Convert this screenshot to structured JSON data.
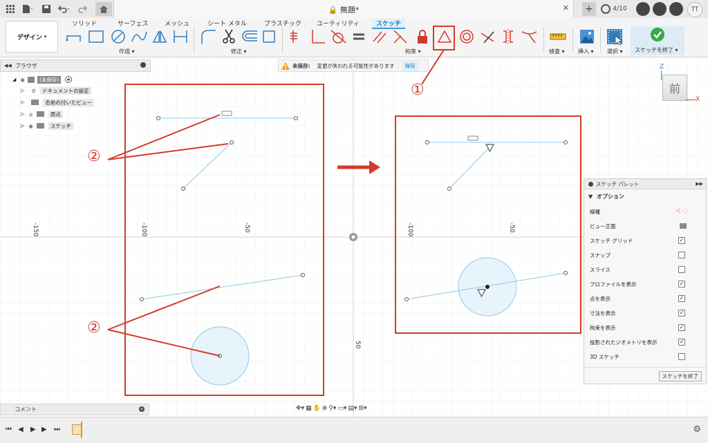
{
  "title_bar": {
    "document_title": "無題*",
    "job_status": "4/10",
    "user_initials": "TT",
    "icons": [
      "grid-icon",
      "file-icon",
      "save-icon",
      "undo-icon",
      "redo-icon",
      "home-icon",
      "close-icon",
      "plus-icon",
      "clock-icon",
      "bell-icon",
      "help-icon"
    ]
  },
  "ribbon": {
    "workspace": "デザイン",
    "tabs": [
      "ソリッド",
      "サーフェス",
      "メッシュ",
      "シート メタル",
      "プラスチック",
      "ユーティリティ",
      "スケッチ"
    ],
    "active_tab": "スケッチ",
    "groups": {
      "create": "作成",
      "modify": "修正",
      "constraints": "拘束",
      "inspect": "検査",
      "insert": "挿入",
      "select": "選択",
      "finish": "スケッチを終了"
    }
  },
  "browser": {
    "header": "ブラウザ",
    "items": [
      {
        "label": "(未保存)",
        "icon": "component-icon"
      },
      {
        "label": "ドキュメントの設定",
        "icon": "gear-icon"
      },
      {
        "label": "名前の付いたビュー",
        "icon": "folder-icon"
      },
      {
        "label": "原点",
        "icon": "folder-icon"
      },
      {
        "label": "スケッチ",
        "icon": "folder-icon"
      }
    ]
  },
  "warning": {
    "label": "未保存:",
    "message": "変更が失われる可能性があります",
    "action": "保存"
  },
  "viewcube": {
    "face": "前",
    "axis_z": "Z",
    "axis_x": "X"
  },
  "axis_labels": {
    "left_150": "-150",
    "left_100": "-100",
    "left_50": "-50",
    "right_100": "-100",
    "right_50": "-50",
    "vertical_50": "50"
  },
  "annotations": {
    "mark1": "①",
    "mark2a": "②",
    "mark2b": "②"
  },
  "palette": {
    "title": "スケッチ パレット",
    "section": "オプション",
    "rows": [
      {
        "label": "線種",
        "type": "icon"
      },
      {
        "label": "ビュー正面",
        "type": "icon"
      },
      {
        "label": "スケッチ グリッド",
        "checked": true
      },
      {
        "label": "スナップ",
        "checked": false
      },
      {
        "label": "スライス",
        "checked": false
      },
      {
        "label": "プロファイルを表示",
        "checked": true
      },
      {
        "label": "点を表示",
        "checked": true
      },
      {
        "label": "寸法を表示",
        "checked": true
      },
      {
        "label": "拘束を表示",
        "checked": true
      },
      {
        "label": "投影されたジオメトリを表示",
        "checked": true
      },
      {
        "label": "3D スケッチ",
        "checked": false
      }
    ],
    "finish_button": "スケッチを終了",
    "check_mark": "✓"
  },
  "comments": {
    "label": "コメント"
  },
  "colors": {
    "accent": "#3d9ad8",
    "annotation_red": "#d43a2a",
    "sketch_line": "#8ec8e8",
    "finish_green": "#39a84a"
  }
}
